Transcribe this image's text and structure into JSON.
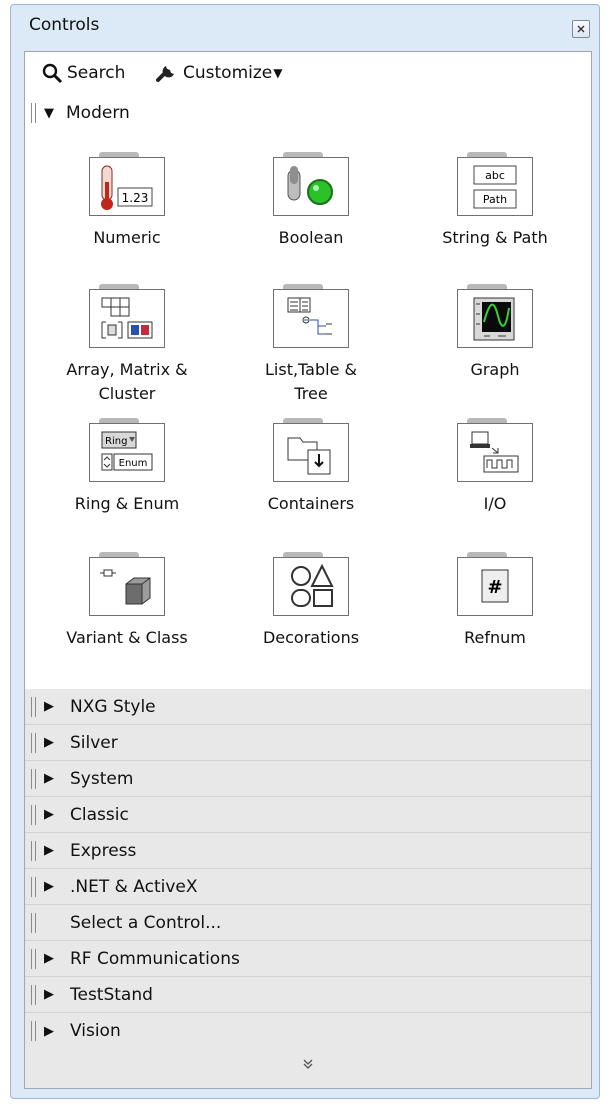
{
  "window": {
    "title": "Controls"
  },
  "toolbar": {
    "search_label": "Search",
    "customize_label": "Customize"
  },
  "modern": {
    "label": "Modern",
    "items": [
      {
        "label": "Numeric",
        "icon": "numeric-icon"
      },
      {
        "label": "Boolean",
        "icon": "boolean-icon"
      },
      {
        "label": "String & Path",
        "icon": "string-path-icon"
      },
      {
        "label": "Array, Matrix &\nCluster",
        "icon": "array-matrix-cluster-icon"
      },
      {
        "label": "List,Table &\nTree",
        "icon": "list-table-tree-icon"
      },
      {
        "label": "Graph",
        "icon": "graph-icon"
      },
      {
        "label": "Ring & Enum",
        "icon": "ring-enum-icon"
      },
      {
        "label": "Containers",
        "icon": "containers-icon"
      },
      {
        "label": "I/O",
        "icon": "io-icon"
      },
      {
        "label": "Variant & Class",
        "icon": "variant-class-icon"
      },
      {
        "label": "Decorations",
        "icon": "decorations-icon"
      },
      {
        "label": "Refnum",
        "icon": "refnum-icon"
      }
    ],
    "icon_text": {
      "numeric": "1.23",
      "string": "abc",
      "path": "Path",
      "ring": "Ring",
      "enum": "Enum",
      "refnum": "#"
    }
  },
  "categories": [
    {
      "label": "NXG Style",
      "expandable": true
    },
    {
      "label": "Silver",
      "expandable": true
    },
    {
      "label": "System",
      "expandable": true
    },
    {
      "label": "Classic",
      "expandable": true
    },
    {
      "label": "Express",
      "expandable": true
    },
    {
      "label": ".NET & ActiveX",
      "expandable": true
    },
    {
      "label": "Select a Control...",
      "expandable": false
    },
    {
      "label": "RF Communications",
      "expandable": true
    },
    {
      "label": "TestStand",
      "expandable": true
    },
    {
      "label": "Vision",
      "expandable": true
    }
  ]
}
